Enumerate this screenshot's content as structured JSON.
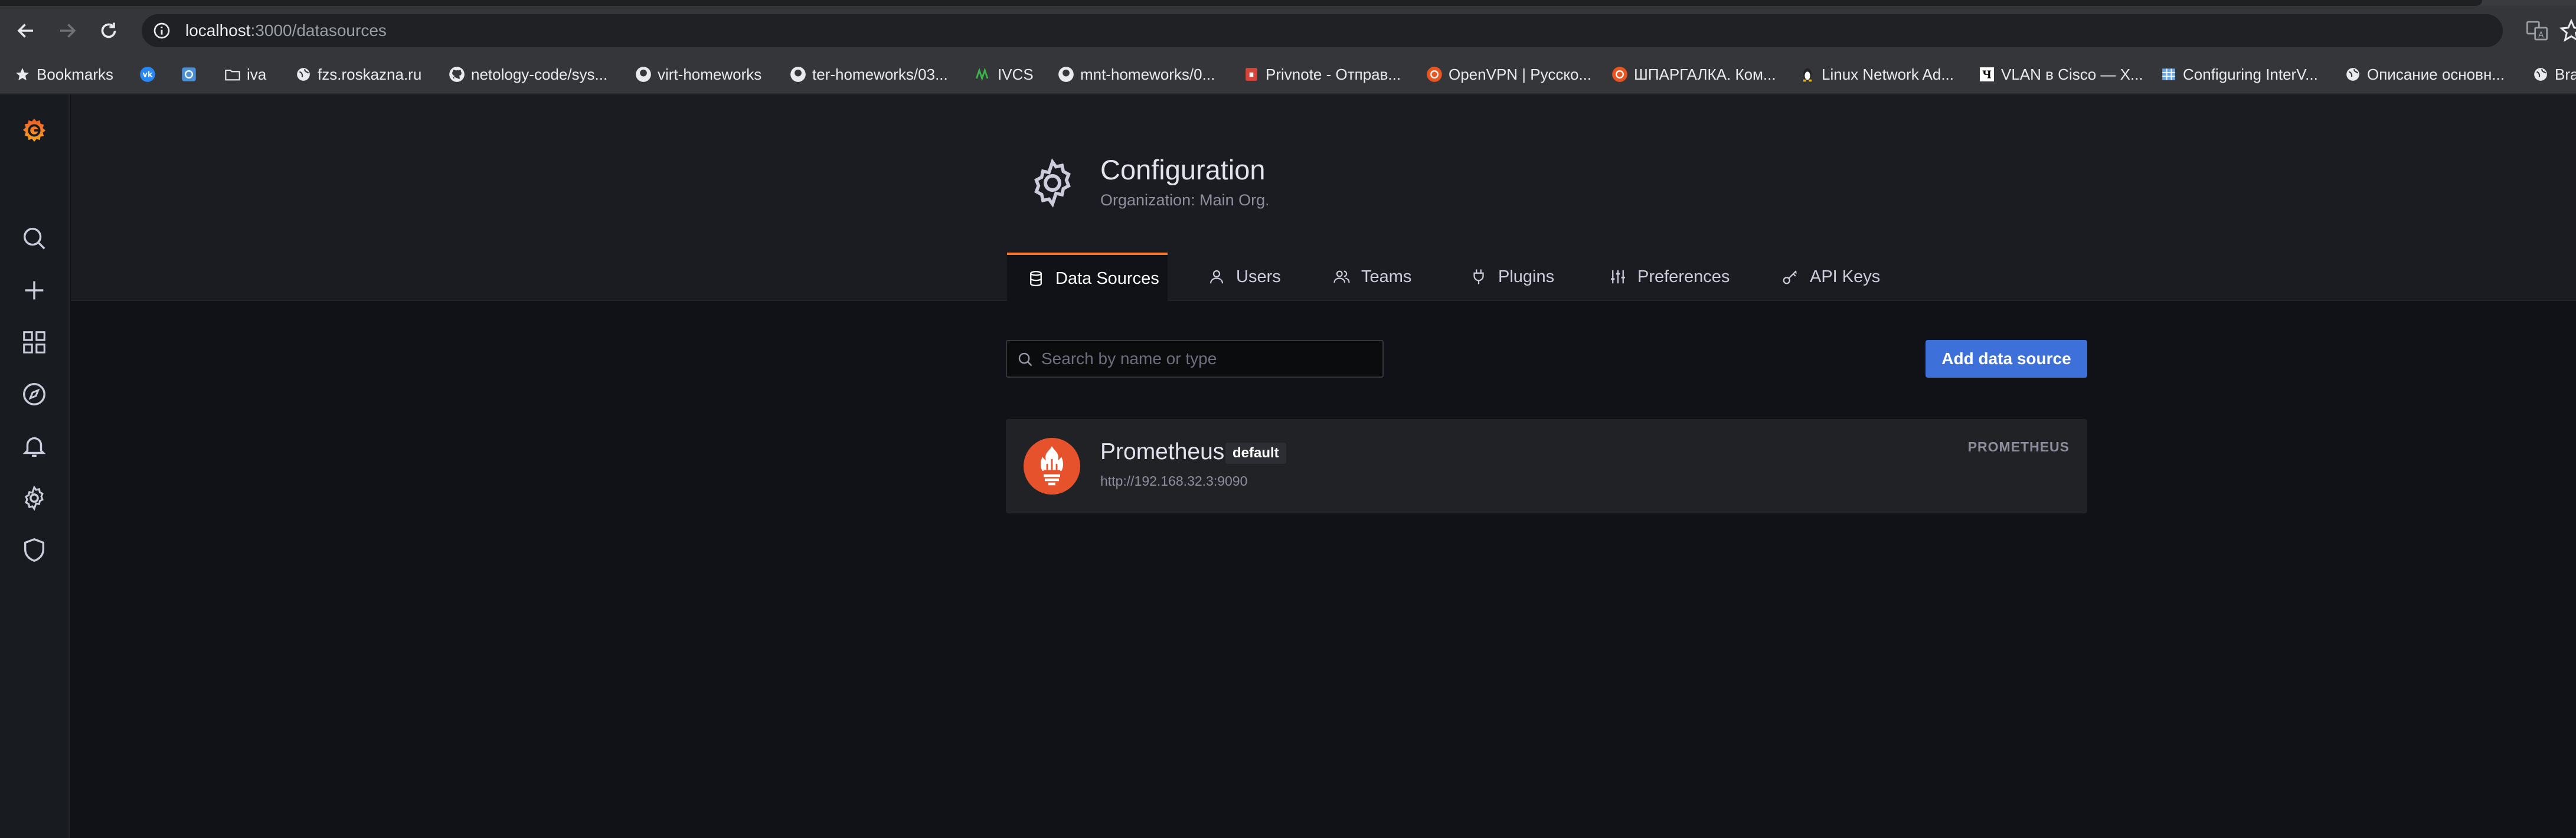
{
  "browser": {
    "url_host": "localhost",
    "url_path": ":3000/datasources"
  },
  "bookmarks": [
    {
      "label": "Bookmarks",
      "icon": "star-icon"
    },
    {
      "label": "",
      "icon": "vk-icon"
    },
    {
      "label": "",
      "icon": "app-icon"
    },
    {
      "label": "iva",
      "icon": "folder-icon"
    },
    {
      "label": "fzs.roskazna.ru",
      "icon": "globe-icon"
    },
    {
      "label": "netology-code/sys...",
      "icon": "github-icon"
    },
    {
      "label": "virt-homeworks",
      "icon": "github-icon"
    },
    {
      "label": "ter-homeworks/03...",
      "icon": "github-icon"
    },
    {
      "label": "IVCS",
      "icon": "ivcs-icon"
    },
    {
      "label": "mnt-homeworks/0...",
      "icon": "github-icon"
    },
    {
      "label": "Privnote - Отправ...",
      "icon": "privnote-icon"
    },
    {
      "label": "OpenVPN | Русско...",
      "icon": "ubuntu-icon"
    },
    {
      "label": "ШПАРГАЛКА. Ком...",
      "icon": "ubuntu-icon"
    },
    {
      "label": "Linux Network Ad...",
      "icon": "linux-icon"
    },
    {
      "label": "VLAN в Cisco — Х...",
      "icon": "wiki-icon"
    },
    {
      "label": "Configuring InterV...",
      "icon": "table-icon"
    },
    {
      "label": "Описание основн...",
      "icon": "globe-icon"
    },
    {
      "label": "Bra",
      "icon": "globe-icon"
    }
  ],
  "header": {
    "title": "Configuration",
    "subtitle": "Organization: Main Org."
  },
  "tabs": [
    {
      "label": "Data Sources",
      "icon": "database-icon",
      "active": true
    },
    {
      "label": "Users",
      "icon": "user-icon"
    },
    {
      "label": "Teams",
      "icon": "users-icon"
    },
    {
      "label": "Plugins",
      "icon": "plug-icon"
    },
    {
      "label": "Preferences",
      "icon": "sliders-icon"
    },
    {
      "label": "API Keys",
      "icon": "key-icon"
    }
  ],
  "search": {
    "placeholder": "Search by name or type",
    "value": ""
  },
  "add_button_label": "Add data source",
  "datasources": [
    {
      "name": "Prometheus",
      "badge": "default",
      "url": "http://192.168.32.3:9090",
      "type": "PROMETHEUS"
    }
  ],
  "colors": {
    "accent": "#f8742d",
    "primary_button": "#3d71d9",
    "prometheus_logo": "#e6522c"
  }
}
